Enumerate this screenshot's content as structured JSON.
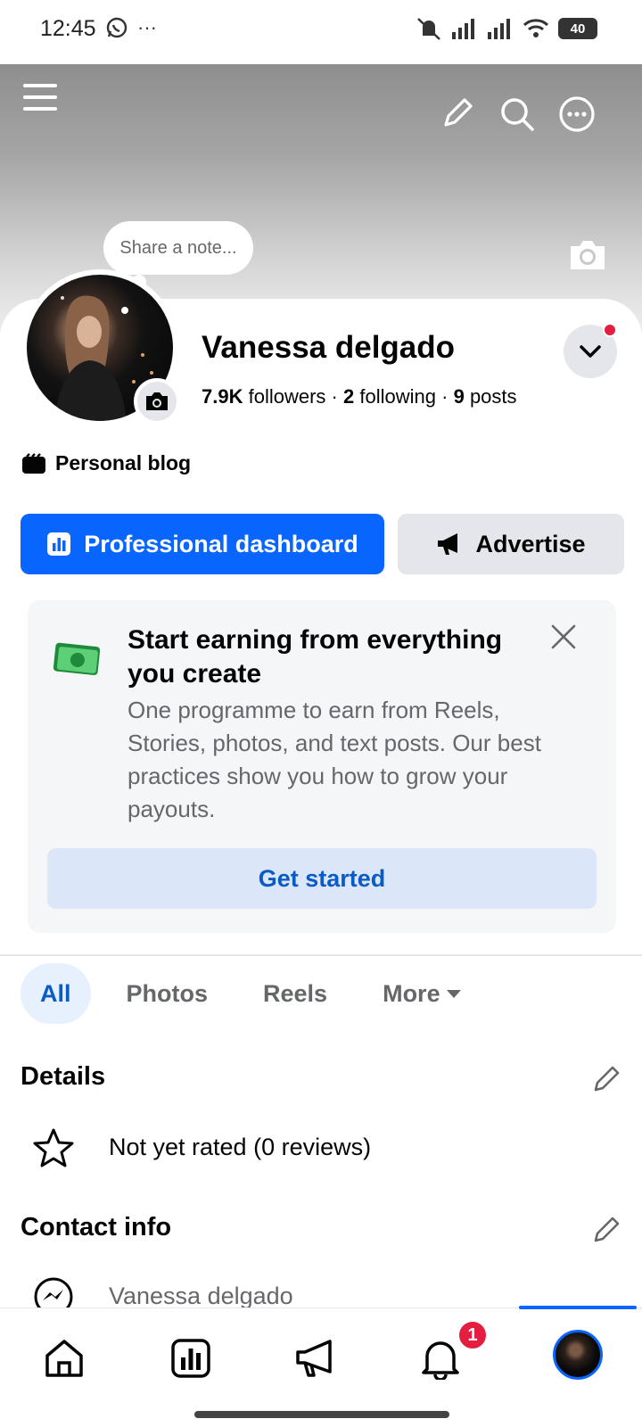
{
  "status_bar": {
    "time": "12:45",
    "more": "···",
    "battery": "40"
  },
  "profile": {
    "note_placeholder": "Share a note...",
    "name": "Vanessa delgado",
    "followers_count": "7.9K",
    "followers_label": "followers",
    "following_count": "2",
    "following_label": "following",
    "posts_count": "9",
    "posts_label": "posts",
    "separator": "·",
    "category": "Personal blog"
  },
  "actions": {
    "dashboard_label": "Professional dashboard",
    "advertise_label": "Advertise"
  },
  "earn_card": {
    "title": "Start earning from everything you create",
    "body": "One programme to earn from Reels, Stories, photos, and text posts. Our best practices show you how to grow your payouts.",
    "cta": "Get started"
  },
  "tabs": [
    {
      "label": "All",
      "active": true
    },
    {
      "label": "Photos"
    },
    {
      "label": "Reels"
    },
    {
      "label": "More"
    }
  ],
  "details": {
    "title": "Details",
    "rating_text": "Not yet rated (0 reviews)"
  },
  "contact": {
    "title": "Contact info",
    "messenger_name": "Vanessa delgado"
  },
  "bottom_nav": {
    "notification_badge": "1"
  },
  "colors": {
    "primary": "#0866ff",
    "badge": "#e41e3f",
    "secondary_bg": "#e4e6eb"
  },
  "icons": [
    "menu-icon",
    "pencil-icon",
    "search-icon",
    "more-icon",
    "camera-icon",
    "chevron-down-icon",
    "clapperboard-icon",
    "bar-chart-icon",
    "megaphone-icon",
    "money-icon",
    "close-icon",
    "caret-down-icon",
    "star-icon",
    "messenger-icon",
    "home-icon",
    "dashboard-icon",
    "bell-icon"
  ]
}
